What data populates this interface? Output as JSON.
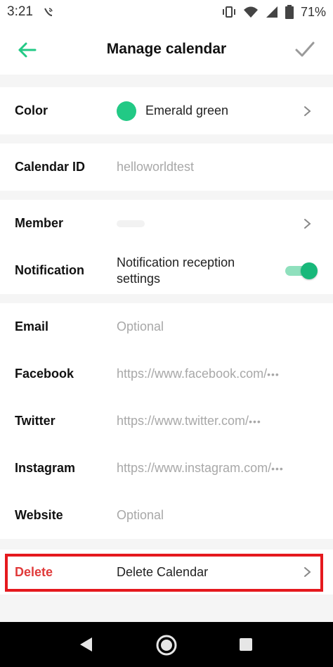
{
  "status_bar": {
    "time": "3:21",
    "battery_percent": "71%",
    "icons": [
      "wifi-calling-icon",
      "vibrate-icon",
      "wifi-icon",
      "cell-signal-icon",
      "battery-icon"
    ]
  },
  "header": {
    "title": "Manage calendar",
    "back_icon": "arrow-left-icon",
    "confirm_icon": "check-icon"
  },
  "colors": {
    "accent": "#22c985",
    "delete_red": "#e03a3a",
    "highlight_red": "#e5191e"
  },
  "rows": {
    "color": {
      "label": "Color",
      "value": "Emerald green"
    },
    "calendar_id": {
      "label": "Calendar ID",
      "value": "helloworldtest"
    },
    "member": {
      "label": "Member"
    },
    "notification": {
      "label": "Notification",
      "value_line1": "Notification reception",
      "value_line2": "settings",
      "enabled": true
    },
    "email": {
      "label": "Email",
      "placeholder": "Optional"
    },
    "facebook": {
      "label": "Facebook",
      "placeholder": "https://www.facebook.com/",
      "ellipsis": "•••"
    },
    "twitter": {
      "label": "Twitter",
      "placeholder": "https://www.twitter.com/",
      "ellipsis": "•••"
    },
    "instagram": {
      "label": "Instagram",
      "placeholder": "https://www.instagram.com/",
      "ellipsis": "•••"
    },
    "website": {
      "label": "Website",
      "placeholder": "Optional"
    },
    "delete": {
      "label": "Delete",
      "value": "Delete Calendar"
    }
  },
  "nav_bar": {
    "icons": [
      "nav-back-icon",
      "nav-home-icon",
      "nav-recents-icon"
    ]
  }
}
